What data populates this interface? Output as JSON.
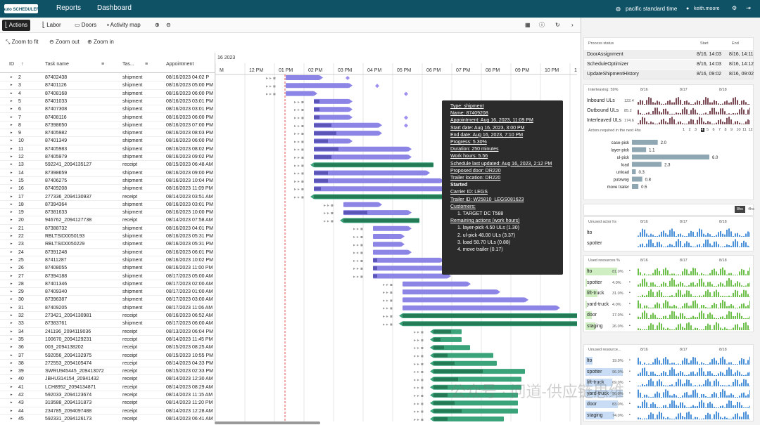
{
  "app": {
    "logo_text": "auto SCHEDULER",
    "nav": [
      "Reports",
      "Dashboard"
    ],
    "timezone": "pacific standard time",
    "user": "keith.moore"
  },
  "toolbar": {
    "tabs": [
      "Actions",
      "Labor",
      "Doors",
      "Activity map"
    ],
    "dc_label": "DC"
  },
  "zoom": {
    "fit": "Zoom to fit",
    "out": "Zoom out",
    "in": "Zoom in"
  },
  "grid": {
    "headers": [
      "ID",
      "Task name",
      "Tas...",
      "Appointment"
    ],
    "rows": [
      [
        "2",
        "87402438",
        "shipment",
        "08/16/2023 04:02 P"
      ],
      [
        "3",
        "87401126",
        "shipment",
        "08/16/2023 05:00 PM"
      ],
      [
        "4",
        "87408168",
        "shipment",
        "08/16/2023 06:00 PM"
      ],
      [
        "5",
        "87401033",
        "shipment",
        "08/16/2023 03:01 PM"
      ],
      [
        "6",
        "87407308",
        "shipment",
        "08/16/2023 03:01 PM"
      ],
      [
        "7",
        "87408116",
        "shipment",
        "08/16/2023 06:00 PM"
      ],
      [
        "8",
        "87398650",
        "shipment",
        "08/16/2023 07:00 PM"
      ],
      [
        "9",
        "87405982",
        "shipment",
        "08/16/2023 08:03 PM"
      ],
      [
        "10",
        "87401349",
        "shipment",
        "08/16/2023 06:00 PM"
      ],
      [
        "11",
        "87405983",
        "shipment",
        "08/16/2023 08:02 PM"
      ],
      [
        "12",
        "87405979",
        "shipment",
        "08/16/2023 09:02 PM"
      ],
      [
        "13",
        "592241_2094135127",
        "receipt",
        "08/15/2023 06:48 AM"
      ],
      [
        "14",
        "87398659",
        "shipment",
        "08/16/2023 09:00 PM"
      ],
      [
        "15",
        "87406275",
        "shipment",
        "08/16/2023 10:04 PM"
      ],
      [
        "16",
        "87409208",
        "shipment",
        "08/16/2023 11:09 PM"
      ],
      [
        "17",
        "277336_2094130937",
        "receipt",
        "08/14/2023 03:51 AM"
      ],
      [
        "18",
        "87394364",
        "shipment",
        "08/16/2023 03:01 PM"
      ],
      [
        "19",
        "87381633",
        "shipment",
        "08/16/2023 10:00 PM"
      ],
      [
        "20",
        "946762_2094127738",
        "receipt",
        "08/14/2023 07:58 AM"
      ],
      [
        "21",
        "87388732",
        "shipment",
        "08/16/2023 04:01 PM"
      ],
      [
        "22",
        "RBLTSID0050193",
        "shipment",
        "08/16/2023 05:31 PM"
      ],
      [
        "23",
        "RBLTSID0050229",
        "shipment",
        "08/16/2023 05:31 PM"
      ],
      [
        "24",
        "87391248",
        "shipment",
        "08/16/2023 06:01 PM"
      ],
      [
        "25",
        "87411287",
        "shipment",
        "08/16/2023 10:02 PM"
      ],
      [
        "26",
        "87408055",
        "shipment",
        "08/16/2023 11:00 PM"
      ],
      [
        "27",
        "87394188",
        "shipment",
        "08/17/2023 05:00 AM"
      ],
      [
        "28",
        "87401346",
        "shipment",
        "08/17/2023 02:00 AM"
      ],
      [
        "29",
        "87409340",
        "shipment",
        "08/17/2023 01:00 AM"
      ],
      [
        "30",
        "87396387",
        "shipment",
        "08/17/2023 03:00 AM"
      ],
      [
        "31",
        "87409205",
        "shipment",
        "08/17/2023 11:06 AM"
      ],
      [
        "32",
        "273421_2094130981",
        "receipt",
        "08/16/2023 06:52 AM"
      ],
      [
        "33",
        "87383761",
        "shipment",
        "08/17/2023 06:00 AM"
      ],
      [
        "34",
        "241196_2094119036",
        "receipt",
        "08/13/2023 06:04 PM"
      ],
      [
        "35",
        "100670_2094129231",
        "receipt",
        "08/14/2023 11:45 PM"
      ],
      [
        "36",
        "003_2094138202",
        "receipt",
        "08/15/2023 08:25 AM"
      ],
      [
        "37",
        "592056_2094132975",
        "receipt",
        "08/15/2023 10:55 PM"
      ],
      [
        "38",
        "272553_2094105474",
        "receipt",
        "08/14/2023 04:33 PM"
      ],
      [
        "39",
        "SWRU945445_209413072",
        "receipt",
        "08/15/2023 02:33 PM"
      ],
      [
        "40",
        "JBHU314154_20941432",
        "receipt",
        "08/14/2023 12:30 AM"
      ],
      [
        "41",
        "LCH8952_2094134871",
        "receipt",
        "08/14/2023 08:29 AM"
      ],
      [
        "42",
        "592033_2094123674",
        "receipt",
        "08/14/2023 11:15 AM"
      ],
      [
        "43",
        "319588_2094131873",
        "receipt",
        "08/14/2023 11:20 PM"
      ],
      [
        "44",
        "234785_2094097488",
        "receipt",
        "08/14/2023 12:28 AM"
      ],
      [
        "45",
        "592331_2094126173",
        "receipt",
        "08/14/2023 06:41 AM"
      ]
    ]
  },
  "timeline": {
    "date": "16 2023",
    "hours": [
      "M",
      "12 PM",
      "01 PM",
      "02 PM",
      "03 PM",
      "04 PM",
      "05 PM",
      "06 PM",
      "07 PM",
      "08 PM",
      "09 PM",
      "10 PM",
      "11 PM"
    ]
  },
  "tooltip": {
    "lines": [
      "Type: shipment",
      "Name: 87409208",
      "Appointment: Aug 16, 2023, 11:09 PM",
      "Start date: Aug 16, 2023, 3:00 PM",
      "End date: Aug 16, 2023, 7:10 PM",
      "Progress: 5.30%",
      "Duration: 250 minutes",
      "Work hours: 5.56",
      "Schedule last updated: Aug 16, 2023, 2:12 PM",
      "Proposed door: DR220",
      "Trailer location: DR220",
      "Started",
      "Carrier ID: LEGS",
      "Trailer ID: W25810_LEGS081623",
      "Customers:",
      "1. TARGET DC T588",
      "Remaining actions (work hours)",
      "1. layer-pick 4.50 ULs (1.30)",
      "2. ul-pick 48.00 ULs (3.37)",
      "3. load 58.70 ULs (0.88)",
      "4. move trailer (0.17)"
    ]
  },
  "process_status": {
    "headers": [
      "Process status",
      "Start",
      "End"
    ],
    "rows": [
      [
        "DoorAssignment",
        "8/16, 14:03",
        "8/16, 14:11"
      ],
      [
        "ScheduleOptimizer",
        "8/16, 14:03",
        "8/16, 14:12"
      ],
      [
        "UpdateShipmentHistory",
        "8/16, 09:02",
        "8/16, 09:02"
      ]
    ]
  },
  "interleaving": {
    "title": "Interleaving: 59%",
    "dates": [
      "8/16",
      "8/17",
      "8/18"
    ],
    "rows": [
      [
        "Inbound ULs",
        "122.4"
      ],
      [
        "Outbound ULs",
        "85.2"
      ],
      [
        "Interleaved ULs",
        "174.6"
      ]
    ]
  },
  "actors": {
    "title": "Actors required in the next 4hs",
    "pages": [
      "1",
      "2",
      "3",
      "4",
      "5",
      "6",
      "7",
      "8",
      "9",
      "10",
      "11",
      "12"
    ],
    "active_page": "4",
    "bars": [
      [
        "case-pick",
        2.0,
        "2.0"
      ],
      [
        "layer-pick",
        1.1,
        "1.1"
      ],
      [
        "ul-pick",
        6.0,
        "6.0"
      ],
      [
        "load",
        2.3,
        "2.3"
      ],
      [
        "unload",
        0.3,
        "0.3"
      ],
      [
        "putaway",
        0.8,
        "0.8"
      ],
      [
        "move trailer",
        0.5,
        "0.5"
      ]
    ],
    "toggle": [
      "8hs",
      "4hs"
    ]
  },
  "unused_actor": {
    "title": "Unused actor hs",
    "dates": [
      "8/16",
      "8/17",
      "8/18"
    ],
    "rows": [
      "lto",
      "spotter"
    ]
  },
  "used_resources": {
    "title": "Used resources %",
    "dates": [
      "8/16",
      "8/17",
      "8/18"
    ],
    "rows": [
      [
        "lto",
        "81.0%",
        0.81
      ],
      [
        "spotter",
        "4.0%",
        0.04
      ],
      [
        "lift-truck",
        "31.0%",
        0.31
      ],
      [
        "yard-truck",
        "4.0%",
        0.04
      ],
      [
        "door",
        "17.0%",
        0.17
      ],
      [
        "staging",
        "26.0%",
        0.26
      ]
    ]
  },
  "unused_resources": {
    "title": "Unused resource...",
    "dates": [
      "8/16",
      "8/17",
      "8/18"
    ],
    "rows": [
      [
        "lto",
        "19.0%",
        0.19
      ],
      [
        "spotter",
        "96.0%",
        0.96
      ],
      [
        "lift-truck",
        "69.0%",
        0.69
      ],
      [
        "yard-truck",
        "96.0%",
        0.96
      ],
      [
        "door",
        "83.0%",
        0.83
      ],
      [
        "staging",
        "74.0%",
        0.74
      ]
    ]
  },
  "watermark": "公众号 · 问道-供应链思维",
  "colors": {
    "topbar": "#0f5266",
    "shipment": "#8c85e6",
    "shipment_dark": "#5b55b8",
    "receipt": "#3aa37a",
    "receipt_dark": "#237a55"
  }
}
